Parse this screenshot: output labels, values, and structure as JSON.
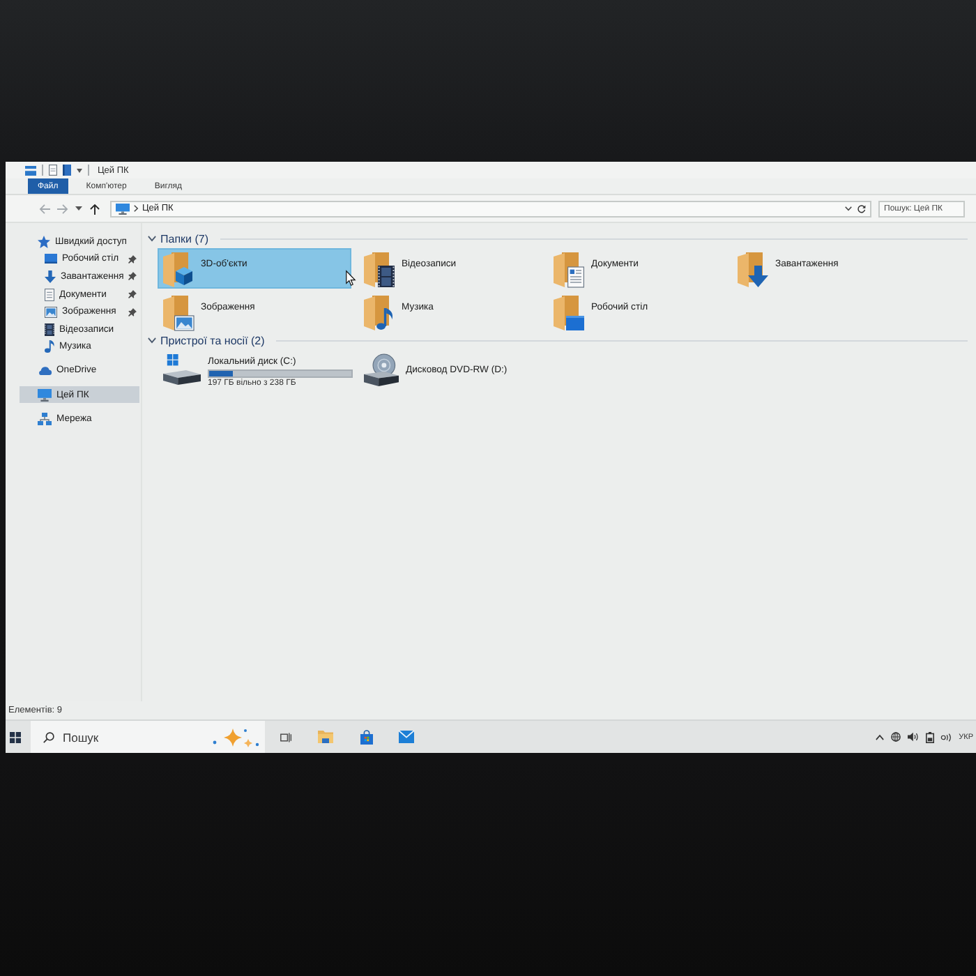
{
  "title_bar": {
    "title": "Цей ПК"
  },
  "ribbon_tabs": [
    {
      "label": "Файл",
      "selected": true
    },
    {
      "label": "Комп'ютер",
      "selected": false
    },
    {
      "label": "Вигляд",
      "selected": false
    }
  ],
  "address_bar": {
    "nav": [
      {
        "kind": "back",
        "disabled": true
      },
      {
        "kind": "forward",
        "disabled": true
      },
      {
        "kind": "recent",
        "disabled": false
      },
      {
        "kind": "up",
        "disabled": false
      }
    ],
    "path": "Цей ПК",
    "search_placeholder": "Пошук: Цей ПК"
  },
  "sidebar": {
    "items": [
      {
        "label": "Швидкий доступ",
        "kind": "quick_access",
        "selected": false,
        "children": [
          {
            "label": "Робочий стіл",
            "kind": "desktop",
            "pinned": true,
            "selected": false
          },
          {
            "label": "Завантаження",
            "kind": "downloads",
            "pinned": true,
            "selected": false
          },
          {
            "label": "Документи",
            "kind": "documents",
            "pinned": true,
            "selected": false
          },
          {
            "label": "Зображення",
            "kind": "pictures",
            "pinned": true,
            "selected": false
          },
          {
            "label": "Відеозаписи",
            "kind": "videos",
            "pinned": false,
            "selected": false
          },
          {
            "label": "Музика",
            "kind": "music",
            "pinned": false,
            "selected": false
          }
        ]
      },
      {
        "label": "OneDrive",
        "kind": "onedrive",
        "selected": false
      },
      {
        "label": "Цей ПК",
        "kind": "pc",
        "selected": true
      },
      {
        "label": "Мережа",
        "kind": "network",
        "selected": false
      }
    ]
  },
  "groups": [
    {
      "title": "Папки (7)",
      "expanded": true,
      "items": [
        {
          "label": "3D-об'єкти",
          "kind": "objects",
          "selected": true
        },
        {
          "label": "Відеозаписи",
          "kind": "videos",
          "selected": false
        },
        {
          "label": "Документи",
          "kind": "documents",
          "selected": false
        },
        {
          "label": "Завантаження",
          "kind": "downloads",
          "selected": false
        },
        {
          "label": "Зображення",
          "kind": "pictures",
          "selected": false
        },
        {
          "label": "Музика",
          "kind": "music",
          "selected": false
        },
        {
          "label": "Робочий стіл",
          "kind": "desktop",
          "selected": false
        }
      ]
    },
    {
      "title": "Пристрої та носії (2)",
      "expanded": true,
      "items": [
        {
          "label": "Локальний диск (C:)",
          "kind": "disk",
          "selected": false,
          "level": 0.17,
          "detail": "197 ГБ вільно з 238 ГБ"
        },
        {
          "label": "Дисковод DVD-RW (D:)",
          "kind": "dvd",
          "selected": false
        }
      ]
    }
  ],
  "status_bar": {
    "text": "Елементів: 9"
  },
  "taskbar": {
    "search_placeholder": "Пошук",
    "language": "УКР"
  }
}
